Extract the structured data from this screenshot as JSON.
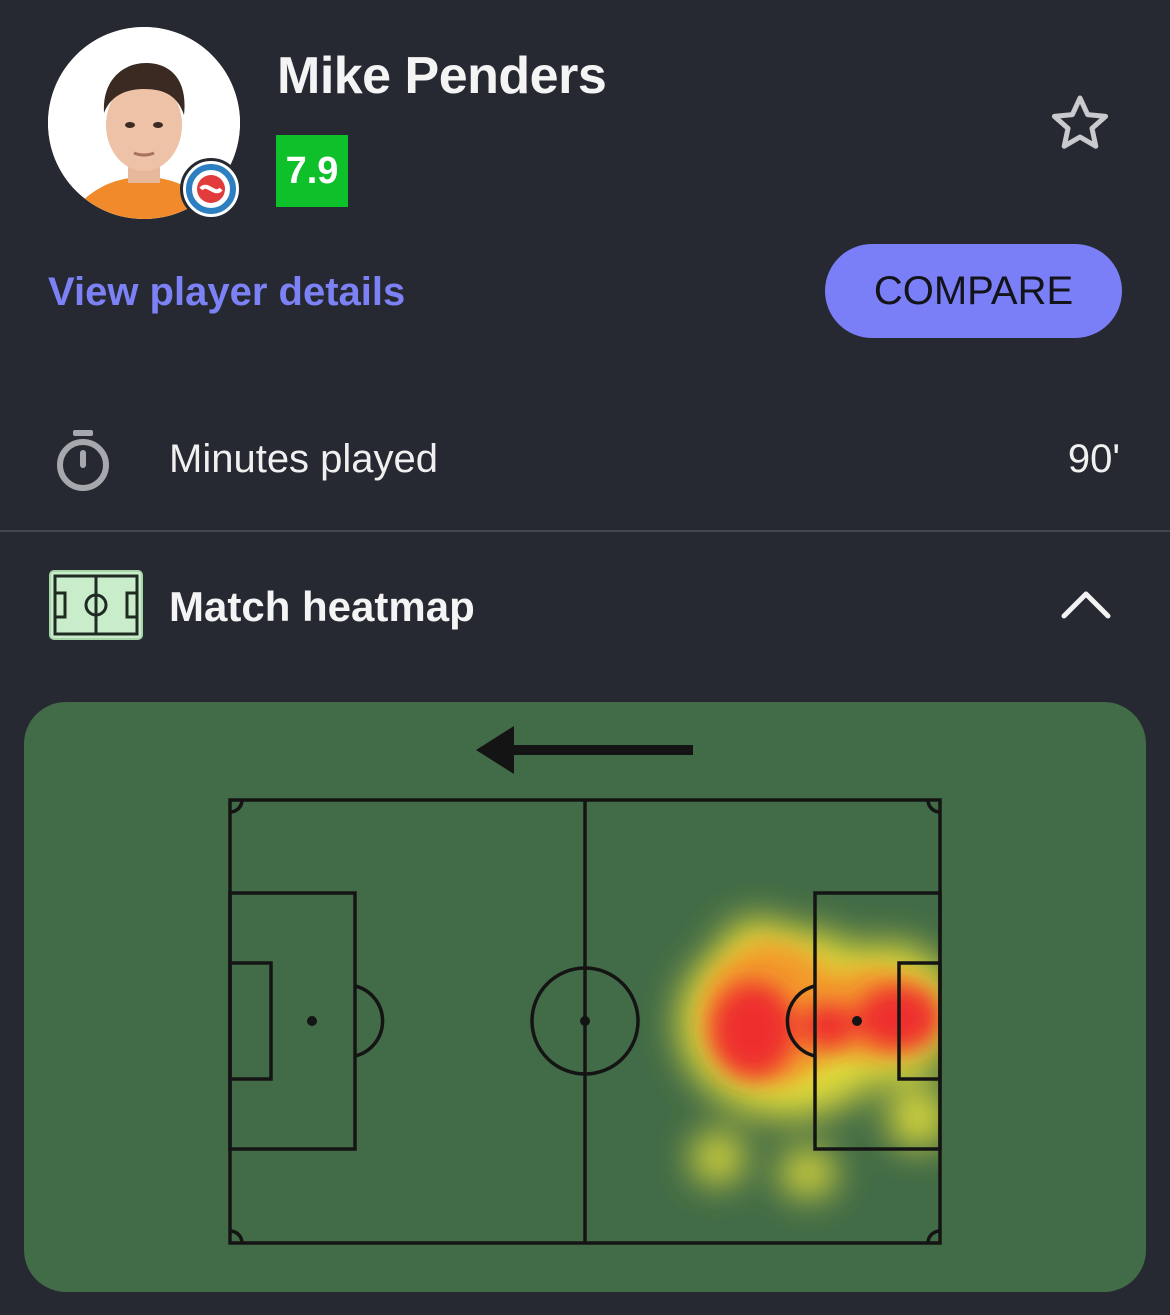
{
  "player": {
    "name": "Mike Penders",
    "rating": "7.9",
    "rating_color": "#0ec02a",
    "avatar_icon": "player-photo",
    "team_badge_icon": "rc-strasbourg-crest"
  },
  "actions": {
    "details_link": "View player details",
    "compare_button": "COMPARE",
    "favorite_icon": "star-outline-icon"
  },
  "stats": [
    {
      "icon": "stopwatch-icon",
      "label": "Minutes played",
      "value": "90'"
    }
  ],
  "heatmap_section": {
    "title": "Match heatmap",
    "icon": "pitch-icon",
    "toggle_icon": "chevron-up-icon",
    "attack_direction": "left",
    "colors": {
      "card": "#426b47",
      "accent": "#7a7ff7"
    }
  }
}
